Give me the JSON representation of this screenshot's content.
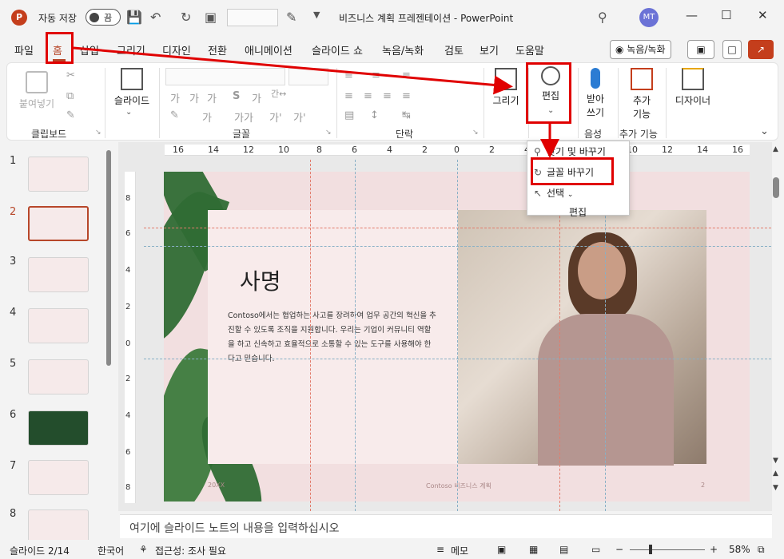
{
  "titlebar": {
    "app_logo": "P",
    "autosave_label": "자동 저장",
    "autosave_state": "끔",
    "window_title": "비즈니스 계획 프레젠테이션  -  PowerPoint",
    "avatar_initials": "MT"
  },
  "tabs": [
    "파일",
    "홈",
    "삽입",
    "그리기",
    "디자인",
    "전환",
    "애니메이션",
    "슬라이드 쇼",
    "녹음/녹화",
    "검토",
    "보기",
    "도움말"
  ],
  "record_button": "녹음/녹화",
  "ribbon": {
    "paste": "붙여넣기",
    "clipboard": "클립보드",
    "slide": "슬라이드",
    "font_group": "글꼴",
    "paragraph_group": "단락",
    "draw": "그리기",
    "edit": "편집",
    "dictate_1": "받아",
    "dictate_2": "쓰기",
    "voice_group": "음성",
    "addins_1": "추가",
    "addins_2": "기능",
    "addins_group": "추가 기능",
    "designer": "디자이너"
  },
  "dropdown": {
    "find_replace": "찾기 및 바꾸기",
    "replace_font": "글꼴 바꾸기",
    "select": "선택",
    "footer": "편집"
  },
  "thumbnails": [
    "1",
    "2",
    "3",
    "4",
    "5",
    "6",
    "7",
    "8"
  ],
  "active_slide": "2",
  "ruler_h": [
    "16",
    "14",
    "12",
    "10",
    "8",
    "6",
    "4",
    "2",
    "0",
    "2",
    "4",
    "6",
    "8",
    "10",
    "12",
    "14",
    "16"
  ],
  "ruler_v": [
    "8",
    "6",
    "4",
    "2",
    "0",
    "2",
    "4",
    "6",
    "8"
  ],
  "slide": {
    "title": "사명",
    "body": "Contoso에서는 협업하는 사고를 장려하여 업무 공간의 혁신을 추진할 수 있도록 조직을 지원합니다. 우리는 기업이 커뮤니티 역할을 하고 신속하고 효율적으로 소통할 수 있는 도구를 사용해야 한다고 믿습니다.",
    "footer_left": "20XX",
    "footer_center": "Contoso 비즈니스 계획",
    "footer_right": "2"
  },
  "notes_placeholder": "여기에 슬라이드 노트의 내용을 입력하십시오",
  "status": {
    "slide_count": "슬라이드 2/14",
    "language": "한국어",
    "accessibility": "접근성: 조사 필요",
    "notes": "메모",
    "zoom": "58%"
  },
  "colors": {
    "accent": "#b7472a",
    "annotation": "#e00000",
    "share": "#c43e1c"
  }
}
